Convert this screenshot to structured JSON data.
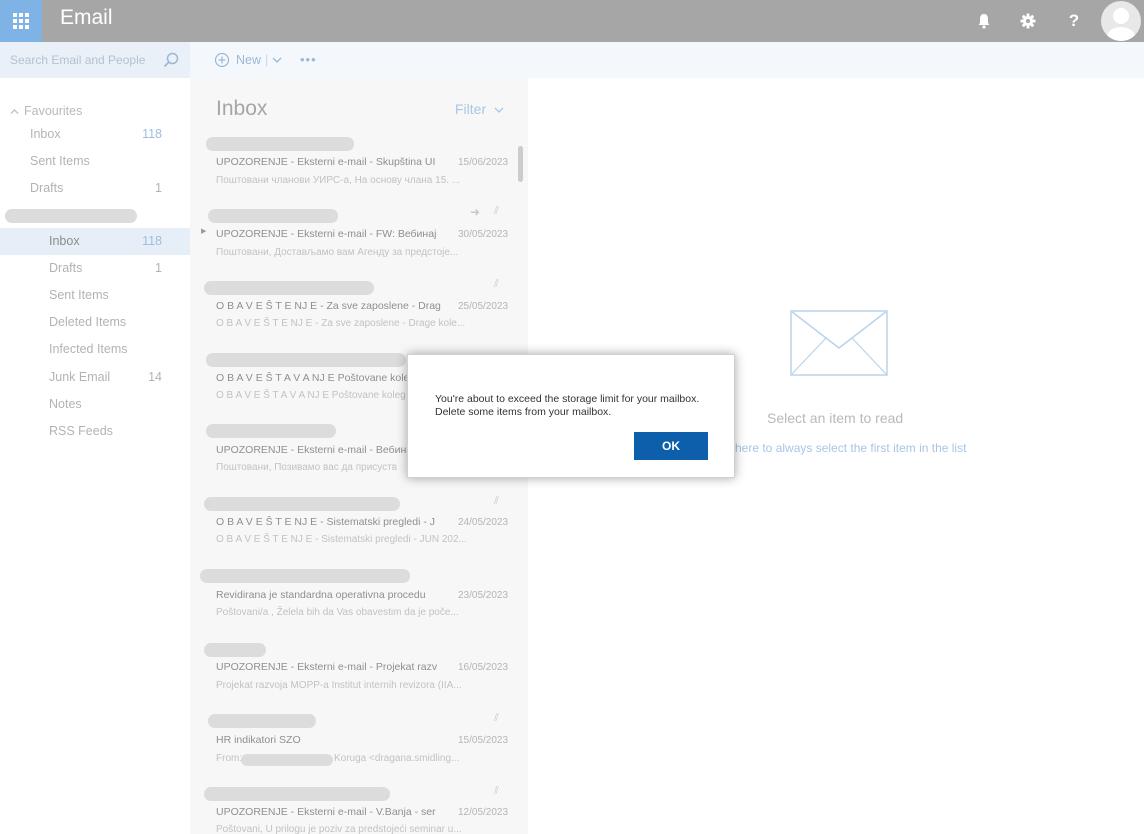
{
  "app": {
    "title": "Email"
  },
  "topbar": {
    "icons": [
      "bell-icon",
      "gear-icon",
      "help-icon",
      "avatar"
    ],
    "help_label": "?"
  },
  "search": {
    "placeholder": "Search Email and People"
  },
  "commands": {
    "new_label": "New",
    "separator": "|",
    "more_label": "•••"
  },
  "nav": {
    "favourites_header": "Favourites",
    "favourites": [
      {
        "label": "Inbox",
        "count": "118"
      },
      {
        "label": "Sent Items",
        "count": ""
      },
      {
        "label": "Drafts",
        "count": "1"
      }
    ],
    "folders": [
      {
        "label": "Inbox",
        "count": "118"
      },
      {
        "label": "Drafts",
        "count": "1"
      },
      {
        "label": "Sent Items",
        "count": ""
      },
      {
        "label": "Deleted Items",
        "count": ""
      },
      {
        "label": "Infected Items",
        "count": ""
      },
      {
        "label": "Junk Email",
        "count": "14"
      },
      {
        "label": "Notes",
        "count": ""
      },
      {
        "label": "RSS Feeds",
        "count": ""
      }
    ]
  },
  "list": {
    "title": "Inbox",
    "filter_label": "Filter",
    "messages": [
      {
        "subject": "UPOZORENJE - Eksterni e-mail - Skupština UI",
        "date": "15/06/2023",
        "preview": "Поштовани чланови УИРС-а, На основу члана 15. ..."
      },
      {
        "subject": "UPOZORENJE - Eksterni e-mail - FW: Вебинај",
        "date": "30/05/2023",
        "preview": "Поштовани, Достављамо вам Агенду за предстоје..."
      },
      {
        "subject": "O B A V E Š T E NJ E - Za sve zaposlene - Drag",
        "date": "25/05/2023",
        "preview": "O B A V E Š T E NJ E - Za sve zaposlene - Drage kole..."
      },
      {
        "subject": "O B A V E Š T A V A NJ E Poštovane kole",
        "date": "",
        "preview": "O B A V E Š T A V A NJ E Poštovane koleg"
      },
      {
        "subject": "UPOZORENJE - Eksterni e-mail - Вебина",
        "date": "",
        "preview": "Поштовани, Позивамо вас да присуств"
      },
      {
        "subject": "O B A V E Š T E NJ E - Sistematski pregledi - J",
        "date": "24/05/2023",
        "preview": "O B A V E Š T E NJ E - Sistematski pregledi - JUN 202..."
      },
      {
        "subject": "Revidirana je standardna operativna procedu",
        "date": "23/05/2023",
        "preview": "Poštovani/a , Želela bih da Vas obavestim da je poče..."
      },
      {
        "subject": "UPOZORENJE - Eksterni e-mail - Projekat razv",
        "date": "16/05/2023",
        "preview": "Projekat razvoja MOPP-a Institut internih revizora (IIA..."
      },
      {
        "subject": "HR indikatori SZO",
        "date": "15/05/2023",
        "preview_prefix": "From:",
        "preview": "Koruga <dragana.smidling..."
      },
      {
        "subject": "UPOZORENJE - Eksterni e-mail - V.Banja - ser",
        "date": "12/05/2023",
        "preview": "Poštovani, U prilogu je poziv za predstojeći seminar u..."
      }
    ]
  },
  "reading": {
    "empty_title": "Select an item to read",
    "empty_link": "here to always select the first item in the list"
  },
  "dialog": {
    "message": "You're about to exceed the storage limit for your mailbox. Delete some items from your mailbox.",
    "ok_label": "OK",
    "ok_color": "#0e5fab"
  }
}
